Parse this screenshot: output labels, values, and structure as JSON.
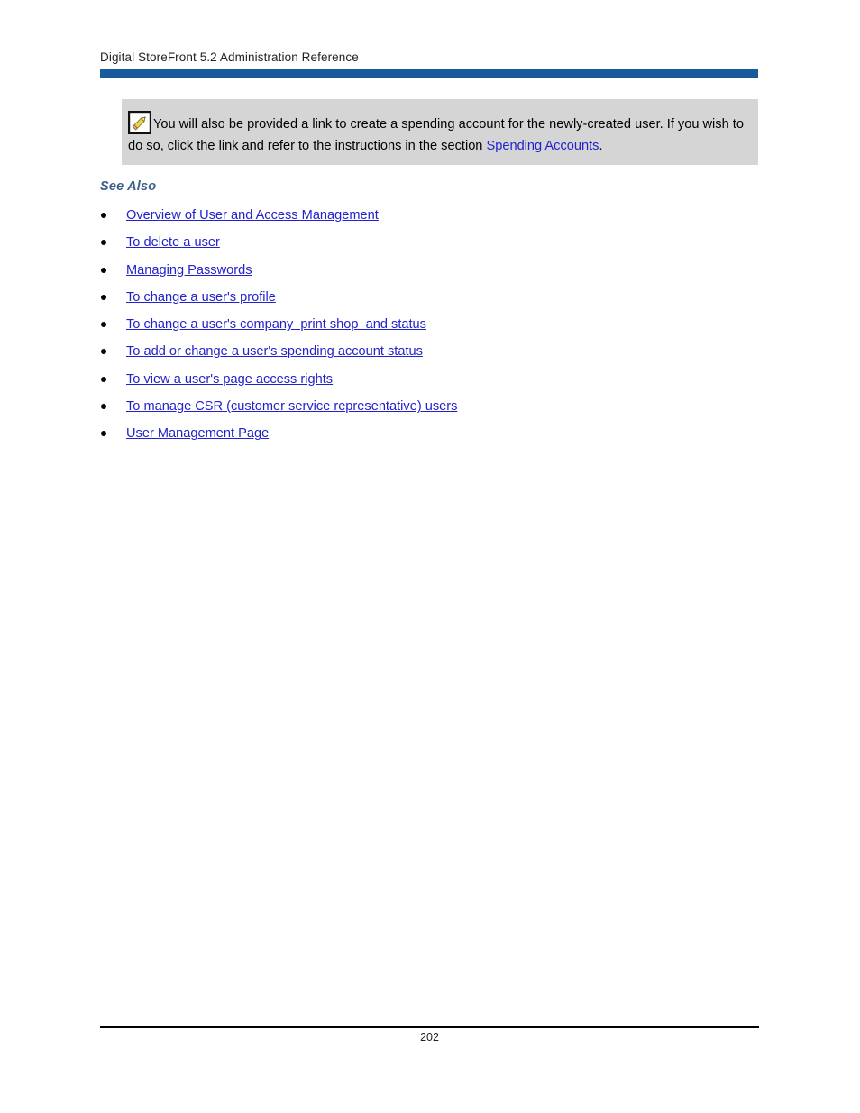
{
  "document": {
    "running_header": "Digital StoreFront 5.2 Administration Reference",
    "header_rule_color": "#185a9b"
  },
  "note": {
    "icon": "pencil-note-icon",
    "background_color": "#d5d5d5",
    "text_before_link": "You will also be provided a link to create a spending account for the newly-created user. If you wish to do so, click the link and refer to the instructions in the section ",
    "link_label": "Spending Accounts",
    "text_after_link": ".",
    "link_color": "#2222cc"
  },
  "see_also": {
    "heading": "See Also",
    "heading_color": "#3d5f8a",
    "links": [
      {
        "label": "Overview of User and Access Management"
      },
      {
        "label": "To delete a user"
      },
      {
        "label": "Managing Passwords"
      },
      {
        "label": "To change a user's profile"
      },
      {
        "label": "To change a user's company  print shop  and status"
      },
      {
        "label": "To add or change a user's spending account status"
      },
      {
        "label": "To view a user's page access rights"
      },
      {
        "label": "To manage CSR (customer service representative) users"
      },
      {
        "label": "User Management Page"
      }
    ]
  },
  "footer": {
    "page_number": "202"
  }
}
